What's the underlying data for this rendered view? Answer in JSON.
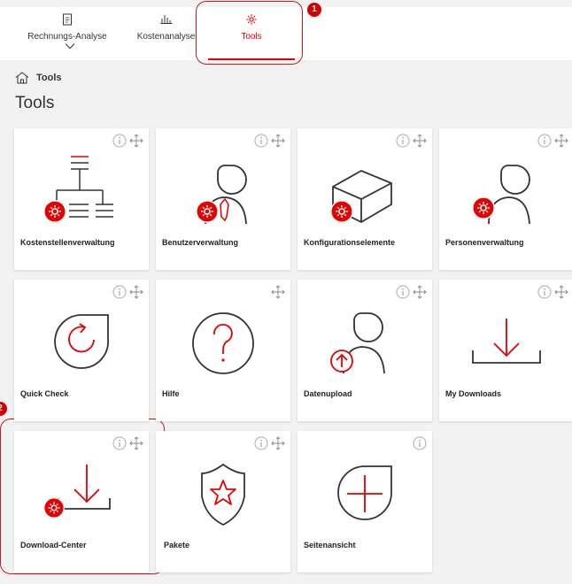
{
  "nav": {
    "items": [
      {
        "label": "Rechnungs-Analyse",
        "icon": "document-icon"
      },
      {
        "label": "Kostenanalyse",
        "icon": "bar-chart-icon"
      },
      {
        "label": "Tools",
        "icon": "gear-icon",
        "active": true
      }
    ]
  },
  "annotations": {
    "one": "1",
    "two": "2"
  },
  "breadcrumb": {
    "label": "Tools",
    "icon": "home-icon"
  },
  "page": {
    "title": "Tools"
  },
  "tiles": [
    {
      "name": "Kostenstellenverwaltung",
      "icon": "org-chart-icon"
    },
    {
      "name": "Benutzerverwaltung",
      "icon": "user-tie-icon"
    },
    {
      "name": "Konfigurationselemente",
      "icon": "cube-icon"
    },
    {
      "name": "Personenverwaltung",
      "icon": "person-icon"
    },
    {
      "name": "Quick Check",
      "icon": "refresh-icon"
    },
    {
      "name": "Hilfe",
      "icon": "question-icon"
    },
    {
      "name": "Datenupload",
      "icon": "upload-person-icon"
    },
    {
      "name": "My Downloads",
      "icon": "download-tray-icon"
    },
    {
      "name": "Download-Center",
      "icon": "download-center-icon"
    },
    {
      "name": "Pakete",
      "icon": "shield-star-icon"
    },
    {
      "name": "Seitenansicht",
      "icon": "plus-bubble-icon"
    }
  ],
  "colors": {
    "accent": "#e60000",
    "text": "#333333",
    "background": "#f2f2f2",
    "tile": "#ffffff"
  }
}
